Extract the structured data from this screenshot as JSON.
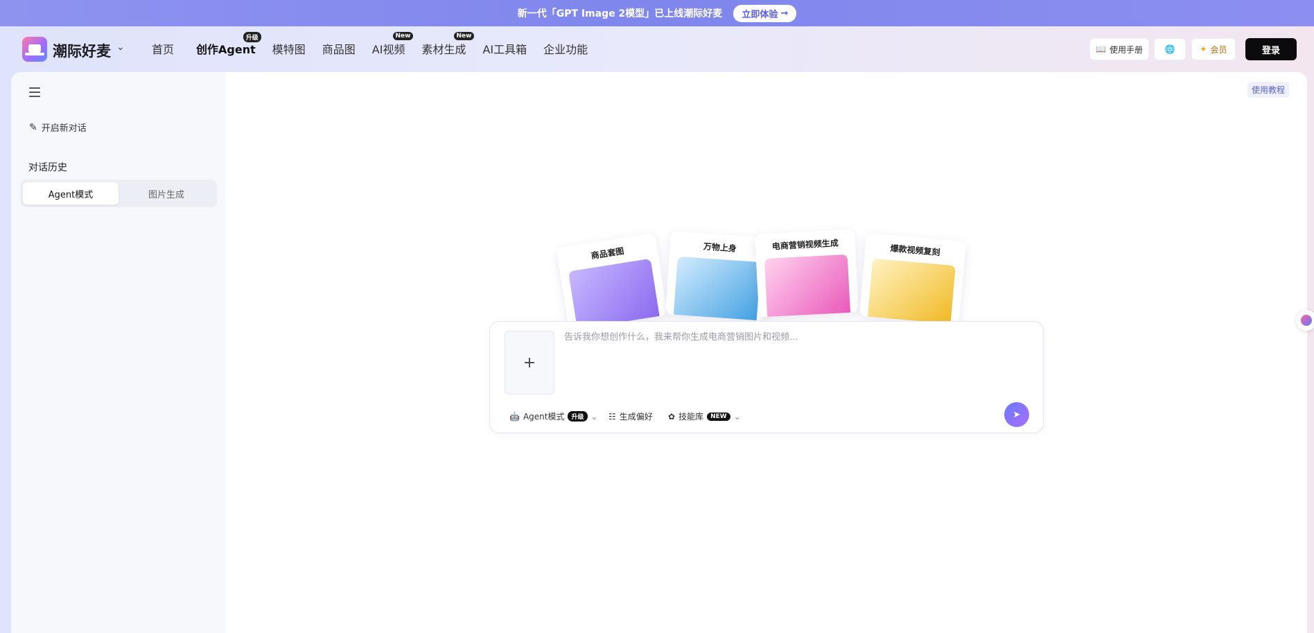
{
  "banner": {
    "text": "新一代「GPT Image 2模型」已上线潮际好麦",
    "button_label": "立即体验",
    "button_arrow": "→"
  },
  "header": {
    "brand": "潮际好麦",
    "nav": [
      {
        "label": "首页"
      },
      {
        "label": "创作Agent",
        "badge": "升级"
      },
      {
        "label": "模特图"
      },
      {
        "label": "商品图"
      },
      {
        "label": "AI视频",
        "badge": "New"
      },
      {
        "label": "素材生成",
        "badge": "New"
      },
      {
        "label": "AI工具箱"
      },
      {
        "label": "企业功能"
      }
    ],
    "manual_label": "使用手册",
    "member_label": "会员",
    "login_label": "登录"
  },
  "sidebar": {
    "new_chat_label": "开启新对话",
    "history_title": "对话历史",
    "tabs": [
      {
        "label": "Agent模式",
        "active": true
      },
      {
        "label": "图片生成",
        "active": false
      }
    ]
  },
  "main": {
    "tutorial_label": "使用教程",
    "cards": [
      {
        "title": "商品套图"
      },
      {
        "title": "万物上身"
      },
      {
        "title": "电商营销视频生成"
      },
      {
        "title": "爆款视频复刻"
      }
    ],
    "composer": {
      "placeholder": "告诉我你想创作什么，我来帮你生成电商营销图片和视频...",
      "tools": {
        "agent_mode_label": "Agent模式",
        "agent_mode_badge": "升级",
        "preference_label": "生成偏好",
        "skills_label": "技能库",
        "skills_badge": "NEW"
      }
    }
  },
  "colors": {
    "accent": "#6a6ff0",
    "login_bg": "#0b0b0d"
  }
}
